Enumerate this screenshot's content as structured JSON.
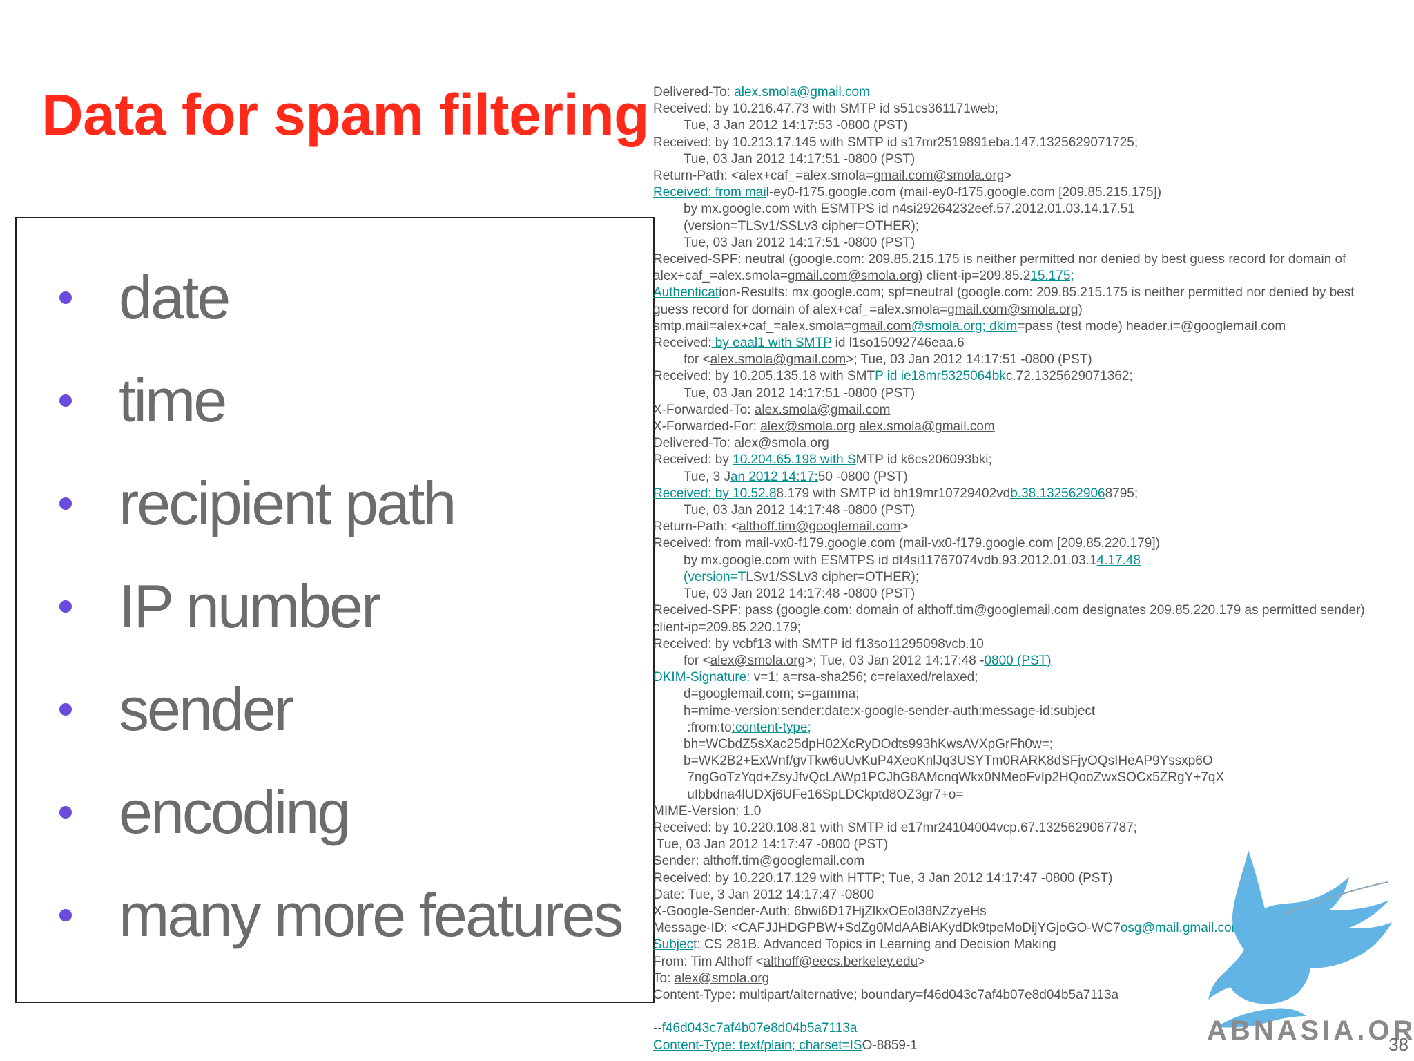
{
  "slide": {
    "title": "Data for spam filtering",
    "page_number": "38",
    "colors": {
      "title": "#ff2a1a",
      "bullet": "#6a4bdc",
      "body_text": "#6c6c6c",
      "link": "#008f8f"
    }
  },
  "features": [
    {
      "text": "date"
    },
    {
      "text": "time"
    },
    {
      "text": "recipient path"
    },
    {
      "text": "IP number"
    },
    {
      "text": "sender"
    },
    {
      "text": "encoding"
    },
    {
      "text": "many more features"
    }
  ],
  "email_header": [
    {
      "indent": 0,
      "parts": [
        {
          "t": "Delivered-To: "
        },
        {
          "t": "alex.smola@gmail.com",
          "s": "link"
        }
      ]
    },
    {
      "indent": 0,
      "parts": [
        {
          "t": "Received: by 10.216.47.73 with SMTP id s51cs361171web;"
        }
      ]
    },
    {
      "indent": 1,
      "parts": [
        {
          "t": "Tue, 3 Jan 2012 14:17:53 -0800 (PST)"
        }
      ]
    },
    {
      "indent": 0,
      "parts": [
        {
          "t": "Received: by 10.213.17.145 with SMTP id s17mr2519891eba.147.1325629071725;"
        }
      ]
    },
    {
      "indent": 1,
      "parts": [
        {
          "t": "Tue, 03 Jan 2012 14:17:51 -0800 (PST)"
        }
      ]
    },
    {
      "indent": 0,
      "parts": [
        {
          "t": "Return-Path: <alex+caf_=alex.smola="
        },
        {
          "t": "gmail.com@smola.org",
          "s": "u"
        },
        {
          "t": ">"
        }
      ]
    },
    {
      "indent": 0,
      "parts": [
        {
          "t": "Received: from mai",
          "s": "link"
        },
        {
          "t": "l-ey0-f175.google.com (mail-ey0-f175.google.com [209.85.215.175])"
        }
      ]
    },
    {
      "indent": 1,
      "parts": [
        {
          "t": "by mx.google.com with ESMTPS id n4si29264232eef.57.2012.01.03.14.17.51"
        }
      ]
    },
    {
      "indent": 1,
      "parts": [
        {
          "t": "(version=TLSv1/SSLv3 cipher=OTHER);"
        }
      ]
    },
    {
      "indent": 1,
      "parts": [
        {
          "t": "Tue, 03 Jan 2012 14:17:51 -0800 (PST)"
        }
      ]
    },
    {
      "indent": 0,
      "parts": [
        {
          "t": "Received-SPF: neutral (google.com: 209.85.215.175 is neither permitted nor denied by best guess record for domain of"
        }
      ]
    },
    {
      "indent": 0,
      "parts": [
        {
          "t": "alex+caf_=alex.smola="
        },
        {
          "t": "gmail.com@smola.org",
          "s": "u"
        },
        {
          "t": ") client-ip=209.85.2"
        },
        {
          "t": "15.175;",
          "s": "link"
        }
      ]
    },
    {
      "indent": 0,
      "parts": [
        {
          "t": "Authenticat",
          "s": "link"
        },
        {
          "t": "ion-Results: mx.google.com; spf=neutral (google.com: 209.85.215.175 is neither permitted nor denied by best"
        }
      ]
    },
    {
      "indent": 0,
      "parts": [
        {
          "t": "guess record for domain of alex+caf_=alex.smola="
        },
        {
          "t": "gmail.com@smola.org",
          "s": "u"
        },
        {
          "t": ")"
        }
      ]
    },
    {
      "indent": 0,
      "parts": [
        {
          "t": "smtp.mail=alex+caf_=alex.smola="
        },
        {
          "t": "gmail.com",
          "s": "u"
        },
        {
          "t": "@smola.org; dkim",
          "s": "link"
        },
        {
          "t": "=pass (test mode) header.i=@googlemail.com"
        }
      ]
    },
    {
      "indent": 0,
      "parts": [
        {
          "t": "Received:"
        },
        {
          "t": " by eaal1 with SMTP",
          "s": "link"
        },
        {
          "t": " id l1so15092746eaa.6"
        }
      ]
    },
    {
      "indent": 1,
      "parts": [
        {
          "t": "for <"
        },
        {
          "t": "alex.smola@gmail.com",
          "s": "u"
        },
        {
          "t": ">; Tue, 03 Jan 2012 14:17:51 -0800 (PST)"
        }
      ]
    },
    {
      "indent": 0,
      "parts": [
        {
          "t": "Received: by 10.205.135.18 with SMT"
        },
        {
          "t": "P id ie18mr5325064bk",
          "s": "link"
        },
        {
          "t": "c.72.1325629071362;"
        }
      ]
    },
    {
      "indent": 1,
      "parts": [
        {
          "t": "Tue, 03 Jan 2012 14:17:51 -0800 (PST)"
        }
      ]
    },
    {
      "indent": 0,
      "parts": [
        {
          "t": "X-Forwarded-To: "
        },
        {
          "t": "alex.smola@gmail.com",
          "s": "u"
        }
      ]
    },
    {
      "indent": 0,
      "parts": [
        {
          "t": "X-Forwarded-For: "
        },
        {
          "t": "alex@smola.org",
          "s": "u"
        },
        {
          "t": " "
        },
        {
          "t": "alex.smola@gmail.com",
          "s": "u"
        }
      ]
    },
    {
      "indent": 0,
      "parts": [
        {
          "t": "Delivered-To: "
        },
        {
          "t": "alex@smola.org",
          "s": "u"
        }
      ]
    },
    {
      "indent": 0,
      "parts": [
        {
          "t": "Received: by "
        },
        {
          "t": "10.204.65.198 with S",
          "s": "link"
        },
        {
          "t": "MTP id k6cs206093bki;"
        }
      ]
    },
    {
      "indent": 1,
      "parts": [
        {
          "t": "Tue, 3 J"
        },
        {
          "t": "an 2012 14:17:",
          "s": "link"
        },
        {
          "t": "50 -0800 (PST)"
        }
      ]
    },
    {
      "indent": 0,
      "parts": [
        {
          "t": "Received: by 10.52.8",
          "s": "link"
        },
        {
          "t": "8.179 with SMTP id bh19mr10729402vd"
        },
        {
          "t": "b.38.132562906",
          "s": "link"
        },
        {
          "t": "8795;"
        }
      ]
    },
    {
      "indent": 1,
      "parts": [
        {
          "t": "Tue, 03 Jan 2012 14:17:48 -0800 (PST)"
        }
      ]
    },
    {
      "indent": 0,
      "parts": [
        {
          "t": "Return-Path: <"
        },
        {
          "t": "althoff.tim@googlemail.com",
          "s": "u"
        },
        {
          "t": ">"
        }
      ]
    },
    {
      "indent": 0,
      "parts": [
        {
          "t": "Received: from mail-vx0-f179.google.com (mail-vx0-f179.google.com [209.85.220.179])"
        }
      ]
    },
    {
      "indent": 1,
      "parts": [
        {
          "t": "by mx.google.com with ESMTPS id dt4si11767074vdb.93.2012.01.03.1"
        },
        {
          "t": "4.17.48",
          "s": "link"
        }
      ]
    },
    {
      "indent": 1,
      "parts": [
        {
          "t": "(version=T",
          "s": "link"
        },
        {
          "t": "LSv1/SSLv3 cipher=OTHER);"
        }
      ]
    },
    {
      "indent": 1,
      "parts": [
        {
          "t": "Tue, 03 Jan 2012 14:17:48 -0800 (PST)"
        }
      ]
    },
    {
      "indent": 0,
      "parts": [
        {
          "t": "Received-SPF: pass (google.com: domain of "
        },
        {
          "t": "althoff.tim@googlemail.com",
          "s": "u"
        },
        {
          "t": " designates 209.85.220.179 as permitted sender)"
        }
      ]
    },
    {
      "indent": 0,
      "parts": [
        {
          "t": "client-ip=209.85.220.179;"
        }
      ]
    },
    {
      "indent": 0,
      "parts": [
        {
          "t": "Received: by vcbf13 with SMTP id f13so11295098vcb.10"
        }
      ]
    },
    {
      "indent": 1,
      "parts": [
        {
          "t": "for <"
        },
        {
          "t": "alex@smola.org",
          "s": "u"
        },
        {
          "t": ">; Tue, 03 Jan 2012 14:17:48 -"
        },
        {
          "t": "0800 (PST)",
          "s": "link"
        }
      ]
    },
    {
      "indent": 0,
      "parts": [
        {
          "t": "DKIM-Signature:",
          "s": "link"
        },
        {
          "t": " v=1; a=rsa-sha256; c=relaxed/relaxed;"
        }
      ]
    },
    {
      "indent": 1,
      "parts": [
        {
          "t": "d=googlemail.com; s=gamma;"
        }
      ]
    },
    {
      "indent": 1,
      "parts": [
        {
          "t": "h=mime-version:sender:date:x-google-sender-auth:message-id:subject"
        }
      ]
    },
    {
      "indent": 1,
      "parts": [
        {
          "t": " :from:to"
        },
        {
          "t": ":content-type;",
          "s": "link"
        }
      ]
    },
    {
      "indent": 1,
      "parts": [
        {
          "t": "bh=WCbdZ5sXac25dpH02XcRyDOdts993hKwsAVXpGrFh0w=;"
        }
      ]
    },
    {
      "indent": 1,
      "parts": [
        {
          "t": "b=WK2B2+ExWnf/gvTkw6uUvKuP4XeoKnlJq3USYTm0RARK8dSFjyOQsIHeAP9Yssxp6O"
        }
      ]
    },
    {
      "indent": 1,
      "parts": [
        {
          "t": " 7ngGoTzYqd+ZsyJfvQcLAWp1PCJhG8AMcnqWkx0NMeoFvIp2HQooZwxSOCx5ZRgY+7qX"
        }
      ]
    },
    {
      "indent": 1,
      "parts": [
        {
          "t": " uIbbdna4lUDXj6UFe16SpLDCkptd8OZ3gr7+o="
        }
      ]
    },
    {
      "indent": 0,
      "parts": [
        {
          "t": "MIME-Version: 1.0"
        }
      ]
    },
    {
      "indent": 0,
      "parts": [
        {
          "t": "Received: by 10.220.108.81 with SMTP id e17mr24104004vcp.67.1325629067787;"
        }
      ]
    },
    {
      "indent": 0,
      "parts": [
        {
          "t": " Tue, 03 Jan 2012 14:17:47 -0800 (PST)"
        }
      ]
    },
    {
      "indent": 0,
      "parts": [
        {
          "t": "Sender: "
        },
        {
          "t": "althoff.tim@googlemail.com",
          "s": "u"
        }
      ]
    },
    {
      "indent": 0,
      "parts": [
        {
          "t": "Received: by 10.220.17.129 with HTTP; Tue, 3 Jan 2012 14:17:47 -0800 (PST)"
        }
      ]
    },
    {
      "indent": 0,
      "parts": [
        {
          "t": "Date: Tue, 3 Jan 2012 14:17:47 -0800"
        }
      ]
    },
    {
      "indent": 0,
      "parts": [
        {
          "t": "X-Google-Sender-Auth: 6bwi6D17HjZlkxOEol38NZzyeHs"
        }
      ]
    },
    {
      "indent": 0,
      "parts": [
        {
          "t": "Message-ID: <"
        },
        {
          "t": "CAFJJHDGPBW+SdZg0MdAABiAKydDk9tpeMoDijYGjoGO-WC7",
          "s": "u"
        },
        {
          "t": "osg@mail.gmail.com>",
          "s": "link"
        }
      ]
    },
    {
      "indent": 0,
      "parts": [
        {
          "t": "Subjec",
          "s": "link"
        },
        {
          "t": "t: CS 281B. Advanced Topics in Learning and Decision Making"
        }
      ]
    },
    {
      "indent": 0,
      "parts": [
        {
          "t": "From: Tim Althoff <"
        },
        {
          "t": "althoff@eecs.berkeley.edu",
          "s": "u"
        },
        {
          "t": ">"
        }
      ]
    },
    {
      "indent": 0,
      "parts": [
        {
          "t": "To: "
        },
        {
          "t": "alex@smola.org",
          "s": "u"
        }
      ]
    },
    {
      "indent": 0,
      "parts": [
        {
          "t": "Content-Type: multipart/alternative; boundary=f46d043c7af4b07e8d04b5a7113a"
        }
      ]
    },
    {
      "indent": 0,
      "parts": [
        {
          "t": " "
        }
      ]
    },
    {
      "indent": 0,
      "parts": [
        {
          "t": "--"
        },
        {
          "t": "f46d043c7af4b07e8d04b5a7113a",
          "s": "link"
        }
      ]
    },
    {
      "indent": 0,
      "parts": [
        {
          "t": "Content-Type: text/plain; charset=IS",
          "s": "link"
        },
        {
          "t": "O-8859-1"
        }
      ]
    }
  ],
  "watermark": {
    "text": "ABNASIA.ORG",
    "colors": {
      "bird": "#62b4e4",
      "text": "#8a8a8a"
    }
  }
}
